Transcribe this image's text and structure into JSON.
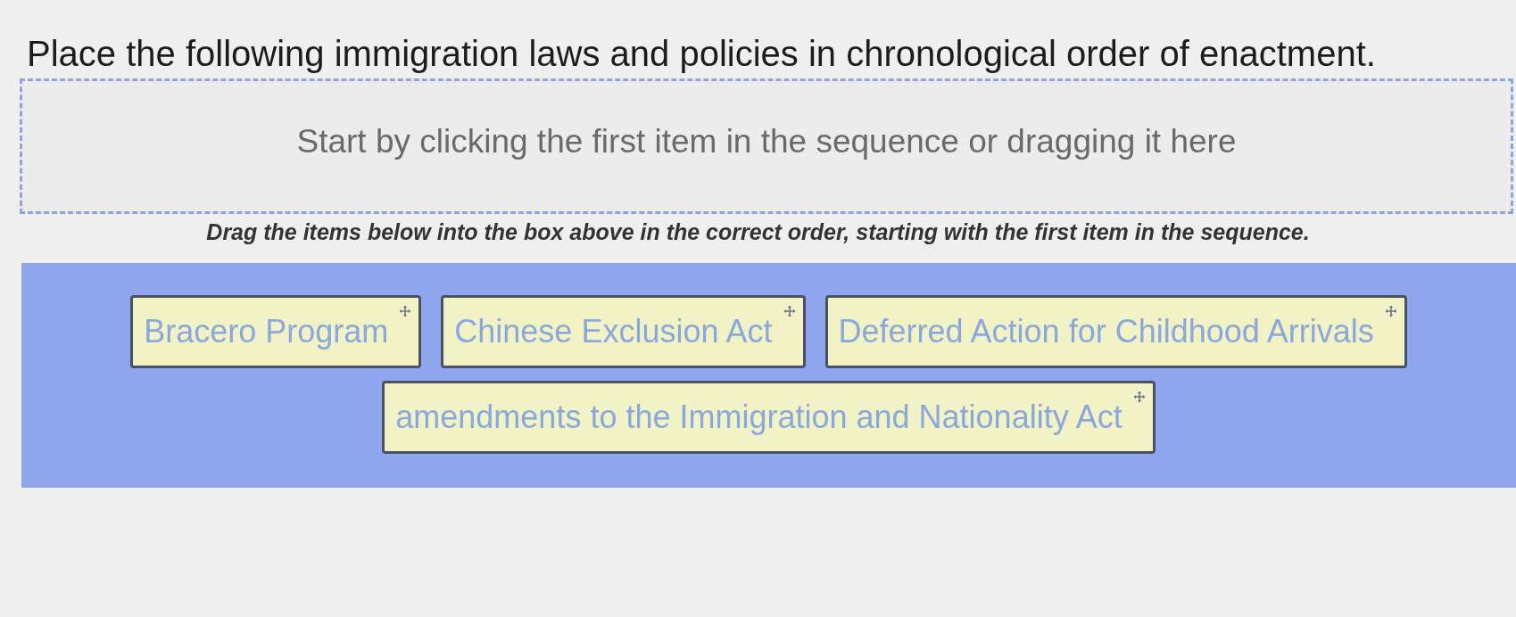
{
  "question": {
    "prompt": "Place the following immigration laws and policies in chronological order of enactment."
  },
  "drop_zone": {
    "placeholder": "Start by clicking the first item in the sequence or dragging it here"
  },
  "instruction": "Drag the items below into the box above in the correct order, starting with the first item in the sequence.",
  "items": [
    {
      "label": "Bracero Program"
    },
    {
      "label": "Chinese Exclusion Act"
    },
    {
      "label": "Deferred Action for Childhood Arrivals"
    },
    {
      "label": "amendments to the Immigration and Nationality Act"
    }
  ]
}
